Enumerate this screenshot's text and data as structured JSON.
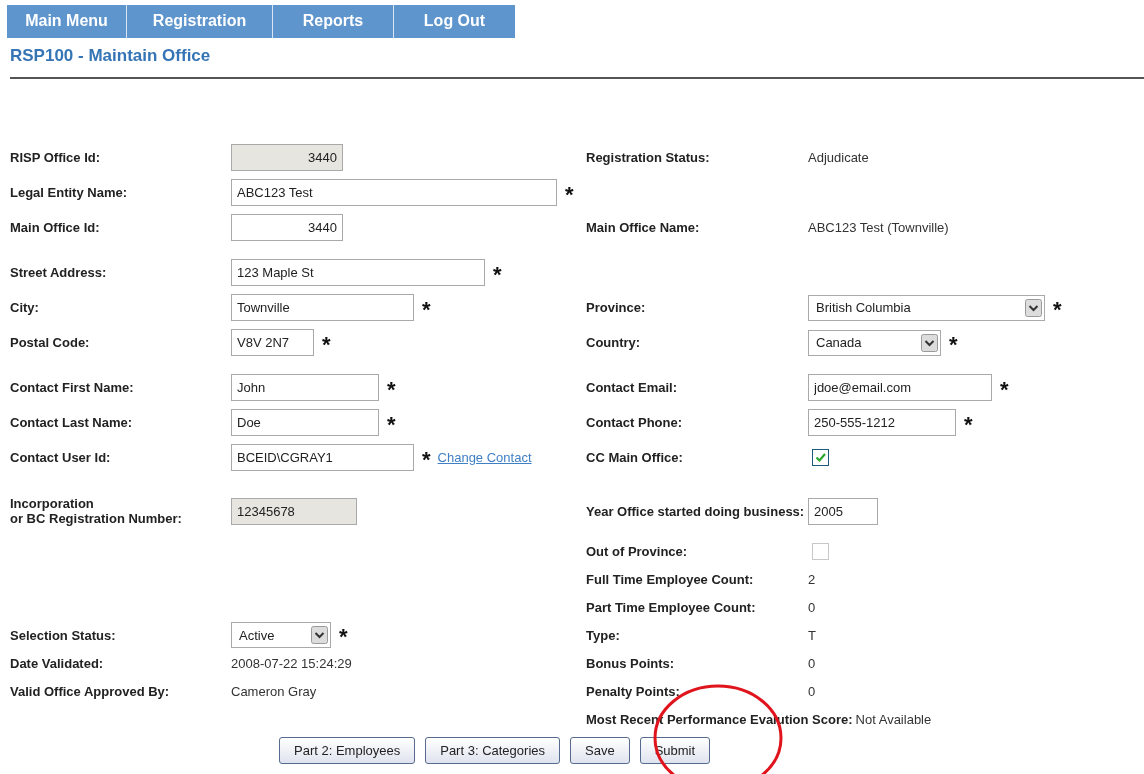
{
  "nav": [
    {
      "label": "Main Menu"
    },
    {
      "label": "Registration"
    },
    {
      "label": "Reports"
    },
    {
      "label": "Log Out"
    }
  ],
  "title": "RSP100 - Maintain Office",
  "required_mark": "*",
  "sections": [
    {
      "rows": [
        {
          "left": {
            "label": "RISP Office Id:",
            "kind": "input",
            "value": "3440",
            "disabled": true,
            "right_aligned": true,
            "required": false
          },
          "right": {
            "label": "Registration Status:",
            "kind": "text",
            "value": "Adjudicate"
          }
        },
        {
          "left": {
            "label": "Legal Entity Name:",
            "kind": "input",
            "value": "ABC123 Test",
            "disabled": false,
            "right_aligned": false,
            "required": true
          }
        },
        {
          "left": {
            "label": "Main Office Id:",
            "kind": "input",
            "value": "3440",
            "disabled": false,
            "right_aligned": true,
            "required": false
          },
          "right": {
            "label": "Main Office Name:",
            "kind": "text",
            "value": "ABC123 Test (Townville)"
          }
        }
      ]
    },
    {
      "rows": [
        {
          "left": {
            "label": "Street Address:",
            "kind": "input",
            "value": "123 Maple St",
            "disabled": false,
            "right_aligned": false,
            "required": true
          }
        },
        {
          "left": {
            "label": "City:",
            "kind": "input",
            "value": "Townville",
            "disabled": false,
            "right_aligned": false,
            "required": true
          },
          "right": {
            "label": "Province:",
            "kind": "select",
            "value": "British Columbia",
            "required": true
          }
        },
        {
          "left": {
            "label": "Postal Code:",
            "kind": "input",
            "value": "V8V 2N7",
            "disabled": false,
            "right_aligned": false,
            "required": true
          },
          "right": {
            "label": "Country:",
            "kind": "select",
            "value": "Canada",
            "required": true
          }
        }
      ]
    },
    {
      "rows": [
        {
          "left": {
            "label": "Contact First Name:",
            "kind": "input",
            "value": "John",
            "disabled": false,
            "right_aligned": false,
            "required": true
          },
          "right": {
            "label": "Contact Email:",
            "kind": "input",
            "value": "jdoe@email.com",
            "disabled": false,
            "right_aligned": false,
            "required": true
          }
        },
        {
          "left": {
            "label": "Contact Last Name:",
            "kind": "input",
            "value": "Doe",
            "disabled": false,
            "right_aligned": false,
            "required": true
          },
          "right": {
            "label": "Contact Phone:",
            "kind": "input",
            "value": "250-555-1212",
            "disabled": false,
            "right_aligned": false,
            "required": true
          }
        },
        {
          "left": {
            "label": "Contact User Id:",
            "kind": "input",
            "value": "BCEID\\CGRAY1",
            "disabled": false,
            "right_aligned": false,
            "required": true,
            "link": "Change Contact"
          },
          "right": {
            "label": "CC Main Office:",
            "kind": "checkbox",
            "checked": true,
            "disabled": false
          }
        }
      ]
    },
    {
      "rows": [
        {
          "left": {
            "label": "Incorporation\nor BC Registration Number:",
            "kind": "input",
            "value": "12345678",
            "disabled": true,
            "right_aligned": false,
            "required": false
          },
          "right": {
            "label": "Year Office started doing business:",
            "kind": "input",
            "value": "2005",
            "disabled": false,
            "right_aligned": false,
            "required": false
          }
        },
        {
          "right": {
            "label": "Out of Province:",
            "kind": "checkbox",
            "checked": false,
            "disabled": true
          }
        },
        {
          "right": {
            "label": "Full Time Employee Count:",
            "kind": "text",
            "value": "2"
          }
        },
        {
          "right": {
            "label": "Part Time Employee Count:",
            "kind": "text",
            "value": "0"
          }
        },
        {
          "left": {
            "label": "Selection Status:",
            "kind": "select",
            "value": "Active",
            "required": true
          },
          "right": {
            "label": "Type:",
            "kind": "text",
            "value": "T"
          }
        },
        {
          "left": {
            "label": "Date Validated:",
            "kind": "text",
            "value": "2008-07-22 15:24:29"
          },
          "right": {
            "label": "Bonus Points:",
            "kind": "text",
            "value": "0"
          }
        },
        {
          "left": {
            "label": "Valid Office Approved By:",
            "kind": "text",
            "value": "Cameron Gray"
          },
          "right": {
            "label": "Penalty Points:",
            "kind": "text",
            "value": "0"
          }
        },
        {
          "right": {
            "label": "Most Recent Performance Evalution Score:",
            "kind": "text",
            "value": "Not Available"
          }
        }
      ]
    }
  ],
  "buttons": [
    {
      "label": "Part 2: Employees"
    },
    {
      "label": "Part 3: Categories"
    },
    {
      "label": "Save"
    },
    {
      "label": "Submit"
    }
  ],
  "annotation": {
    "kind": "circle"
  }
}
